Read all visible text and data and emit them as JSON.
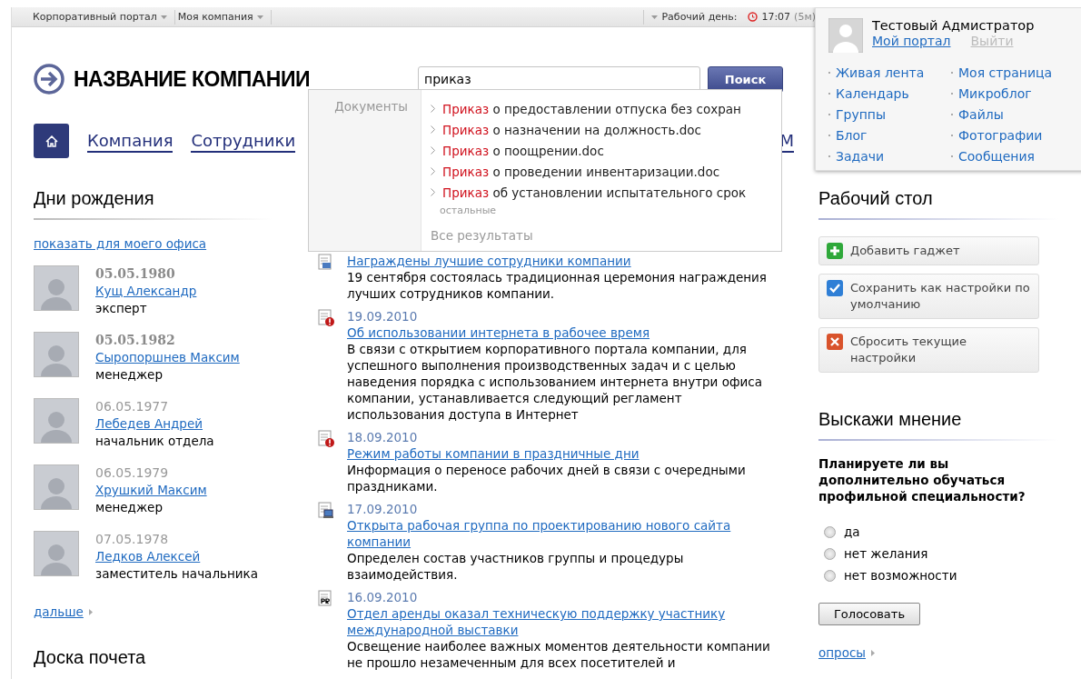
{
  "top_bar": {
    "menus": [
      "Корпоративный портал",
      "Моя компания"
    ],
    "workday_label": "Рабочий день:",
    "time": "17:07",
    "duration": "(5м)"
  },
  "header": {
    "company_name": "НАЗВАНИЕ КОМПАНИИ",
    "search": {
      "value": "приказ",
      "button": "Поиск"
    }
  },
  "nav": {
    "items": [
      "Компания",
      "Сотрудники",
      "М"
    ]
  },
  "search_dropdown": {
    "category": "Документы",
    "results": [
      {
        "match": "Приказ",
        "rest": " о предоставлении отпуска без сохран"
      },
      {
        "match": "Приказ",
        "rest": " о назначении на должность.doc"
      },
      {
        "match": "Приказ",
        "rest": " о поощрении.doc"
      },
      {
        "match": "Приказ",
        "rest": " о проведении инвентаризации.doc"
      },
      {
        "match": "Приказ",
        "rest": " об установлении испытательного срок"
      }
    ],
    "others": "остальные",
    "all_results": "Все результаты"
  },
  "birthdays": {
    "title": "Дни рождения",
    "filter_link": "показать для моего офиса",
    "people": [
      {
        "date": "05.05.1980",
        "name": "Кущ Александр",
        "position": "эксперт",
        "today": true
      },
      {
        "date": "05.05.1982",
        "name": "Сыропоршнев Максим",
        "position": "менеджер",
        "today": true
      },
      {
        "date": "06.05.1977",
        "name": "Лебедев Андрей",
        "position": "начальник отдела",
        "today": false
      },
      {
        "date": "06.05.1979",
        "name": "Хрушкий Максим",
        "position": "менеджер",
        "today": false
      },
      {
        "date": "07.05.1978",
        "name": "Ледков Алексей",
        "position": "заместитель начальника",
        "today": false
      }
    ],
    "more_link": "дальше"
  },
  "honor_board": {
    "title": "Доска почета"
  },
  "news": [
    {
      "kind": "award",
      "title": "Награждены лучшие сотрудники компании",
      "text": "19 сентября состоялась традиционная церемония награждения лучших сотрудников компании."
    },
    {
      "kind": "alert",
      "date": "19.09.2010",
      "title": "Об использовании интернета в рабочее время",
      "text": "В связи с открытием корпоративного портала компании, для успешного выполнения производственных задач и с целью наведения порядка с использованием интернета внутри офиса компании, устанавливается следующий регламент использования доступа в Интернет"
    },
    {
      "kind": "alert",
      "date": "18.09.2010",
      "title": "Режим работы компании в праздничные дни",
      "text": "Информация о переносе рабочих дней в связи с очередными праздниками."
    },
    {
      "kind": "computer",
      "date": "17.09.2010",
      "title": "Открыта рабочая группа по проектированию нового сайта компании",
      "text": "Определен состав участников группы и процедуры взаимодействия."
    },
    {
      "kind": "pr",
      "date": "16.09.2010",
      "title": "Отдел аренды оказал техническую поддержку участнику международной выставки",
      "text": "Освещение наиболее важных моментов деятельности компании не прошло незамеченным для всех посетителей и"
    }
  ],
  "user_panel": {
    "name": "Тестовый Адмистратор",
    "portal_link": "Мой портал",
    "logout_link": "Выйти",
    "links": [
      [
        "Живая лента",
        "Календарь",
        "Группы",
        "Блог",
        "Задачи"
      ],
      [
        "Моя страница",
        "Микроблог",
        "Файлы",
        "Фотографии",
        "Сообщения"
      ]
    ]
  },
  "desktop": {
    "title": "Рабочий стол",
    "actions": [
      {
        "kind": "add",
        "label": "Добавить гаджет"
      },
      {
        "kind": "save",
        "label": "Сохранить как настройки по умолчанию"
      },
      {
        "kind": "reset",
        "label": "Сбросить текущие настройки"
      }
    ]
  },
  "poll": {
    "title": "Выскажи мнение",
    "question": "Планируете ли вы дополнительно обучаться профильной специальности?",
    "options": [
      {
        "label": "да",
        "selected": false
      },
      {
        "label": "нет желания",
        "selected": false
      },
      {
        "label": "нет возможности",
        "selected": false
      }
    ],
    "vote_button": "Голосовать",
    "polls_link": "опросы"
  }
}
